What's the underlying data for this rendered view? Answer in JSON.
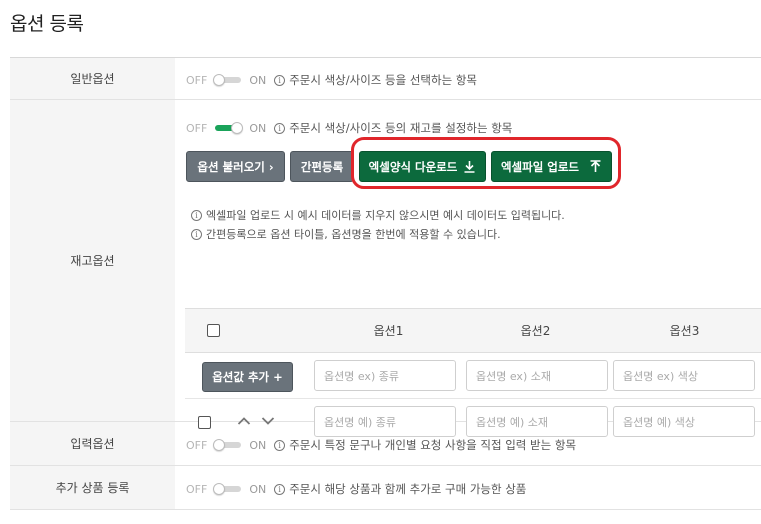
{
  "page": {
    "title": "옵션 등록"
  },
  "toggle_text": {
    "off": "OFF",
    "on": "ON"
  },
  "rows": {
    "general": {
      "label": "일반옵션",
      "toggle_state": "off",
      "hint": "주문시 색상/사이즈 등을 선택하는 항목"
    },
    "stock": {
      "label": "재고옵션",
      "toggle_state": "on",
      "hint": "주문시 색상/사이즈 등의 재고를 설정하는 항목",
      "buttons": {
        "load": "옵션 불러오기 ›",
        "quick": "간편등록",
        "excel_download": "엑셀양식 다운로드",
        "excel_upload": "엑셀파일 업로드"
      },
      "notes": [
        "엑셀파일 업로드 시 예시 데이터를 지우지 않으시면 예시 데이터도 입력됩니다.",
        "간편등록으로 옵션 타이틀, 옵션명을 한번에 적용할 수 있습니다."
      ],
      "table": {
        "columns": [
          "옵션1",
          "옵션2",
          "옵션3"
        ],
        "add_button": "옵션값 추가 +",
        "title_placeholders": [
          "옵션명 ex) 종류",
          "옵션명 ex) 소재",
          "옵션명 ex) 색상"
        ],
        "value_placeholders": [
          "옵션명 예) 종류",
          "옵션명 예) 소재",
          "옵션명 예) 색상"
        ]
      }
    },
    "input": {
      "label": "입력옵션",
      "toggle_state": "off",
      "hint": "주문시 특정 문구나 개인별 요청 사항을 직접 입력 받는 항목"
    },
    "extra": {
      "label": "추가 상품 등록",
      "toggle_state": "off",
      "hint": "주문시 해당 상품과 함께 추가로 구매 가능한 상품"
    }
  },
  "colors": {
    "accent_green": "#0c6a3d",
    "toggle_on": "#1aa35a",
    "button_gray": "#6a737b",
    "highlight_red": "#e0262b"
  },
  "icons": {
    "info": "info-circle-icon",
    "download": "download-icon",
    "upload": "upload-icon",
    "up": "chevron-up-icon",
    "down": "chevron-down-icon"
  }
}
